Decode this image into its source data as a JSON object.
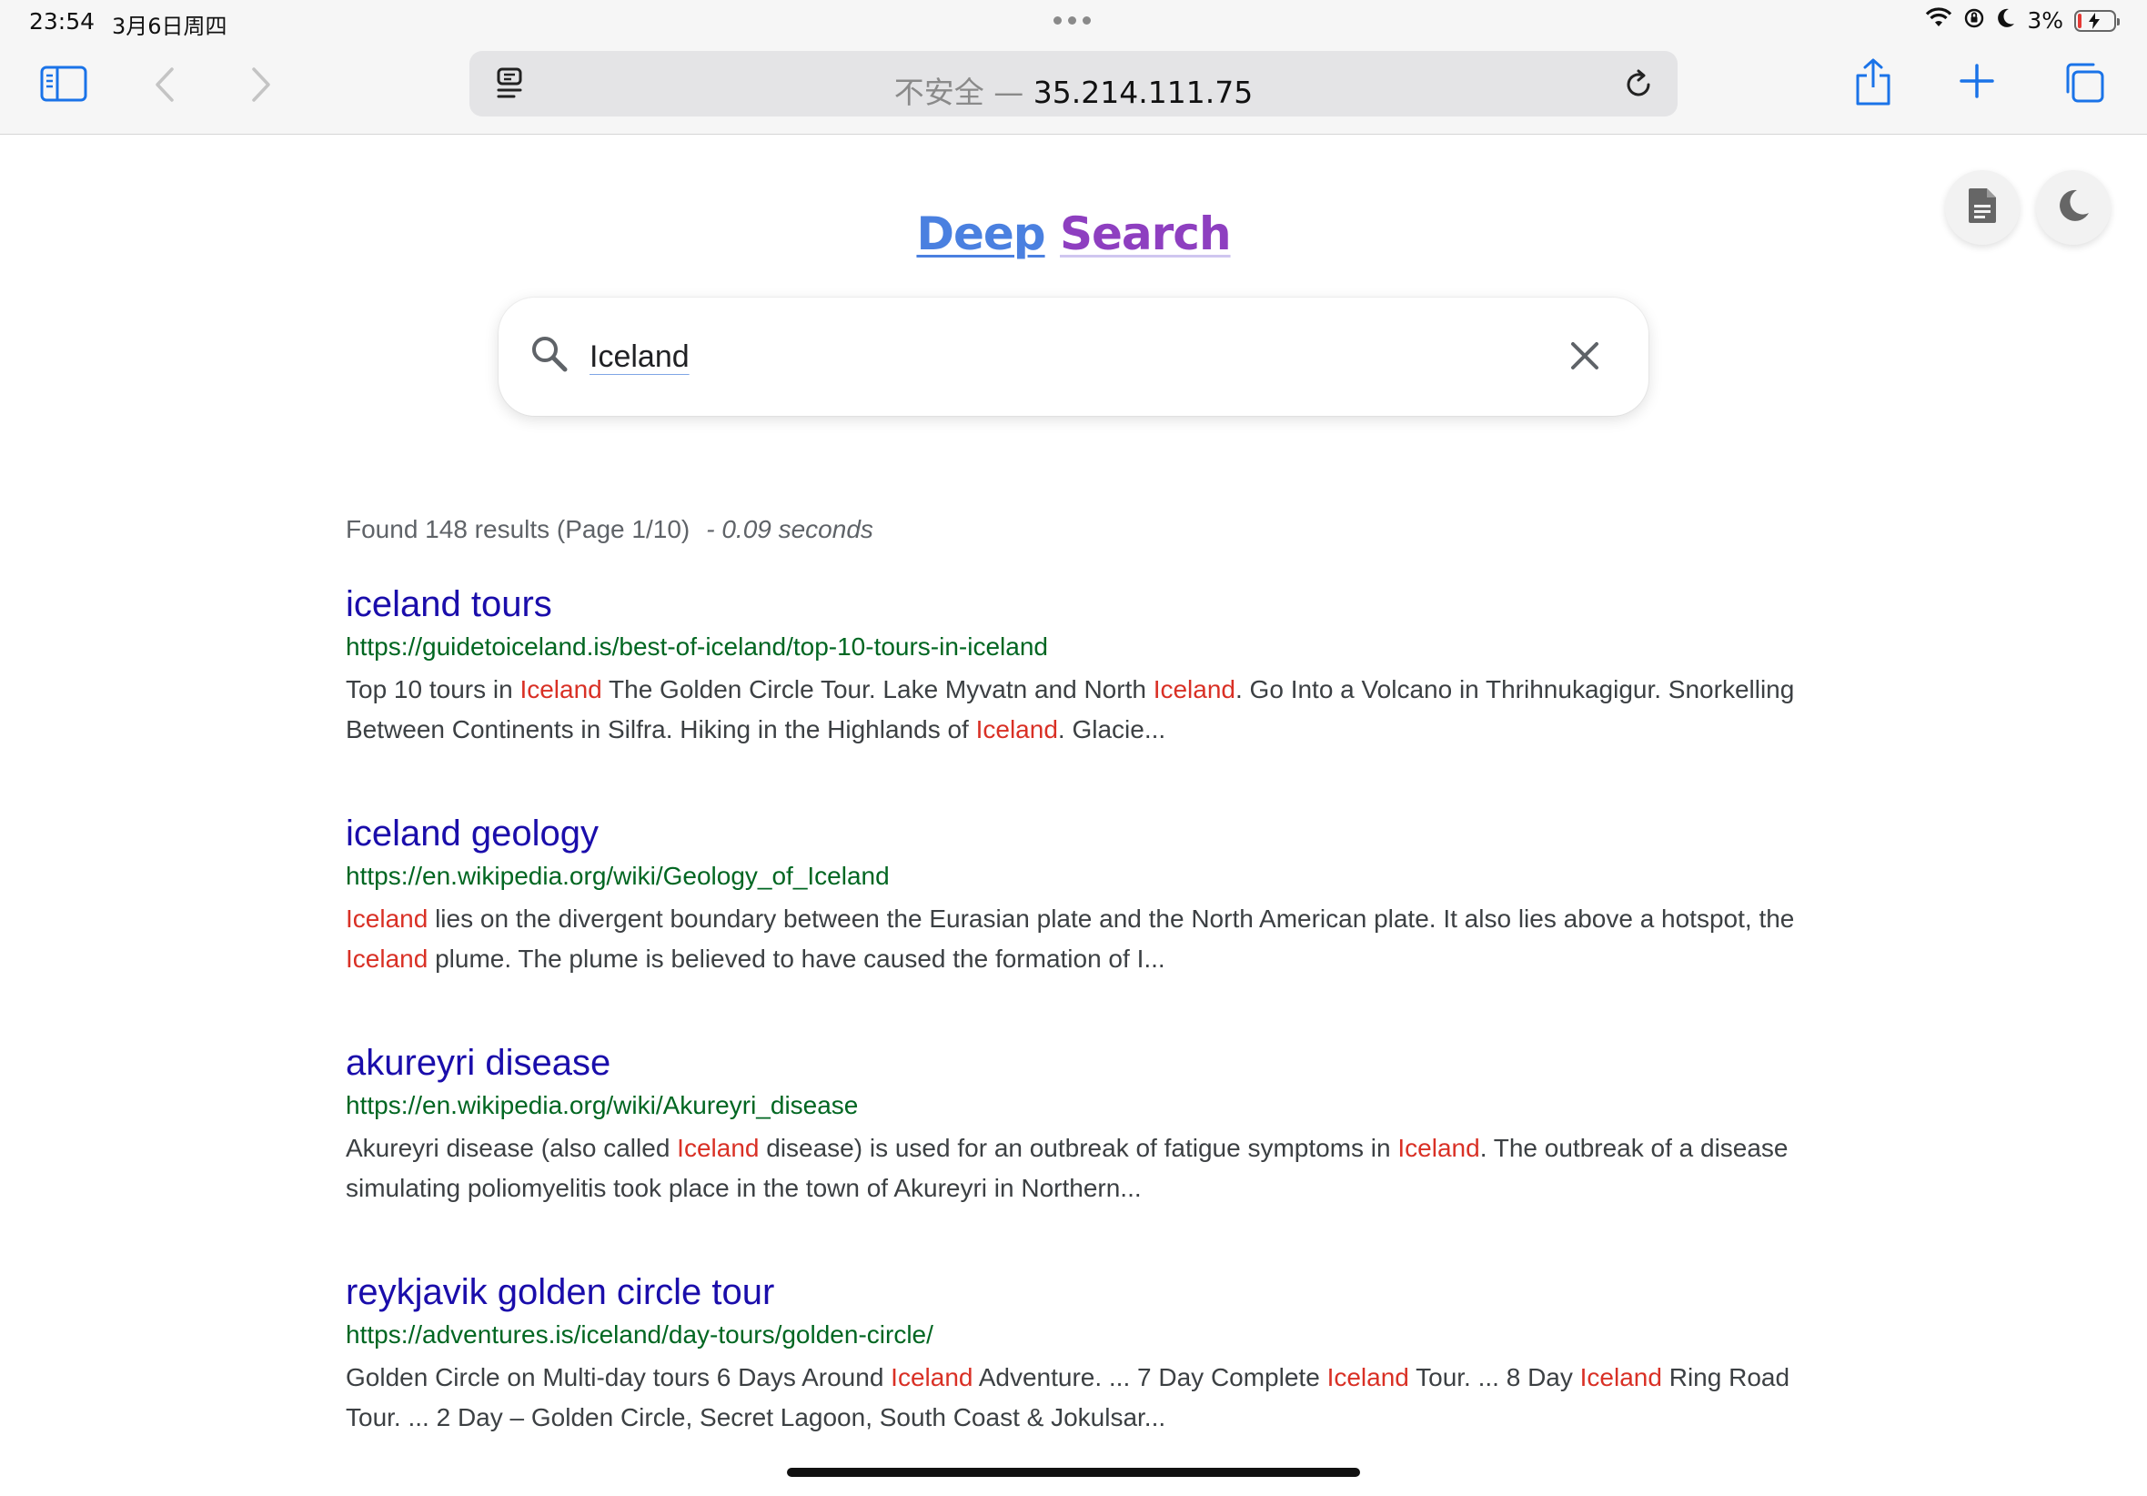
{
  "status_bar": {
    "time": "23:54",
    "date": "3月6日周四",
    "battery_percent": "3%",
    "icons": [
      "wifi-icon",
      "orientation-lock-icon",
      "moon-icon",
      "battery-charging-icon"
    ]
  },
  "toolbar": {
    "address_insecure": "不安全 —",
    "address_host": "35.214.111.75",
    "icons": [
      "sidebar-icon",
      "back-icon",
      "forward-icon",
      "reader-icon",
      "reload-icon",
      "share-icon",
      "new-tab-icon",
      "tabs-icon"
    ]
  },
  "page": {
    "logo_deep": "Deep",
    "logo_search": "Search",
    "search_value": "Iceland",
    "summary_text": "Found 148 results (Page 1/10)",
    "summary_time": "- 0.09 seconds",
    "floating_icons": [
      "document-icon",
      "dark-mode-icon"
    ]
  },
  "results": [
    {
      "title": "iceland tours",
      "url": "https://guidetoiceland.is/best-of-iceland/top-10-tours-in-iceland",
      "snippet": [
        {
          "t": "Top 10 tours in "
        },
        {
          "t": "Iceland",
          "hl": true
        },
        {
          "t": " The Golden Circle Tour. Lake Myvatn and North "
        },
        {
          "t": "Iceland",
          "hl": true
        },
        {
          "t": ". Go Into a Volcano in Thrihnukagigur. Snorkelling Between Continents in Silfra. Hiking in the Highlands of "
        },
        {
          "t": "Iceland",
          "hl": true
        },
        {
          "t": ". Glacie..."
        }
      ]
    },
    {
      "title": "iceland geology",
      "url": "https://en.wikipedia.org/wiki/Geology_of_Iceland",
      "snippet": [
        {
          "t": "Iceland",
          "hl": true
        },
        {
          "t": " lies on the divergent boundary between the Eurasian plate and the North American plate. It also lies above a hotspot, the "
        },
        {
          "t": "Iceland",
          "hl": true
        },
        {
          "t": " plume. The plume is believed to have caused the formation of I..."
        }
      ]
    },
    {
      "title": "akureyri disease",
      "url": "https://en.wikipedia.org/wiki/Akureyri_disease",
      "snippet": [
        {
          "t": "Akureyri disease (also called "
        },
        {
          "t": "Iceland",
          "hl": true
        },
        {
          "t": " disease) is used for an outbreak of fatigue symptoms in "
        },
        {
          "t": "Iceland",
          "hl": true
        },
        {
          "t": ". The outbreak of a disease simulating poliomyelitis took place in the town of Akureyri in Northern..."
        }
      ]
    },
    {
      "title": "reykjavik golden circle tour",
      "url": "https://adventures.is/iceland/day-tours/golden-circle/",
      "snippet": [
        {
          "t": "Golden Circle on Multi-day tours 6 Days Around "
        },
        {
          "t": "Iceland",
          "hl": true
        },
        {
          "t": " Adventure. ... 7 Day Complete "
        },
        {
          "t": "Iceland",
          "hl": true
        },
        {
          "t": " Tour. ... 8 Day "
        },
        {
          "t": "Iceland",
          "hl": true
        },
        {
          "t": " Ring Road Tour. ... 2 Day – Golden Circle, Secret Lagoon, South Coast & Jokulsar..."
        }
      ]
    }
  ],
  "colors": {
    "link": "#1a0dab",
    "url": "#006621",
    "highlight": "#d93025",
    "toolbar_icon": "#1a73e8"
  }
}
